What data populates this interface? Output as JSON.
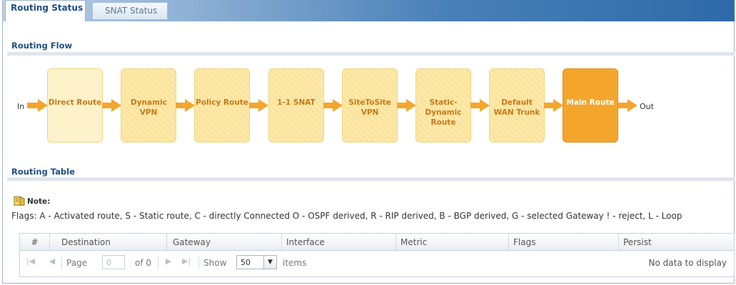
{
  "tabs": [
    {
      "label": "Routing Status",
      "active": true
    },
    {
      "label": "SNAT Status",
      "active": false
    }
  ],
  "routing_flow": {
    "title": "Routing Flow",
    "in_label": "In",
    "out_label": "Out",
    "steps": [
      {
        "label": "Direct Route"
      },
      {
        "label": "Dynamic VPN"
      },
      {
        "label": "Policy Route"
      },
      {
        "label": "1-1 SNAT"
      },
      {
        "label": "SiteToSite VPN"
      },
      {
        "label": "Static-Dynamic Route"
      },
      {
        "label": "Default WAN Trunk"
      },
      {
        "label": "Main Route"
      }
    ]
  },
  "routing_table": {
    "title": "Routing Table",
    "note_title": "Note:",
    "flags_text": "Flags: A - Activated route, S - Static route, C - directly Connected O - OSPF derived, R - RIP derived, B - BGP derived, G - selected Gateway ! - reject, L - Loop",
    "columns": [
      "#",
      "Destination",
      "Gateway",
      "Interface",
      "Metric",
      "Flags",
      "Persist"
    ],
    "pager": {
      "page_label": "Page",
      "page_value": "0",
      "of_label": "of 0",
      "show_label": "Show",
      "page_size": "50",
      "items_label": "items",
      "empty_text": "No data to display"
    }
  },
  "colors": {
    "accent": "#1f4f82",
    "step_fill": "#fbe39a",
    "main_route_fill": "#f4a62c",
    "arrow": "#f4a62c"
  }
}
